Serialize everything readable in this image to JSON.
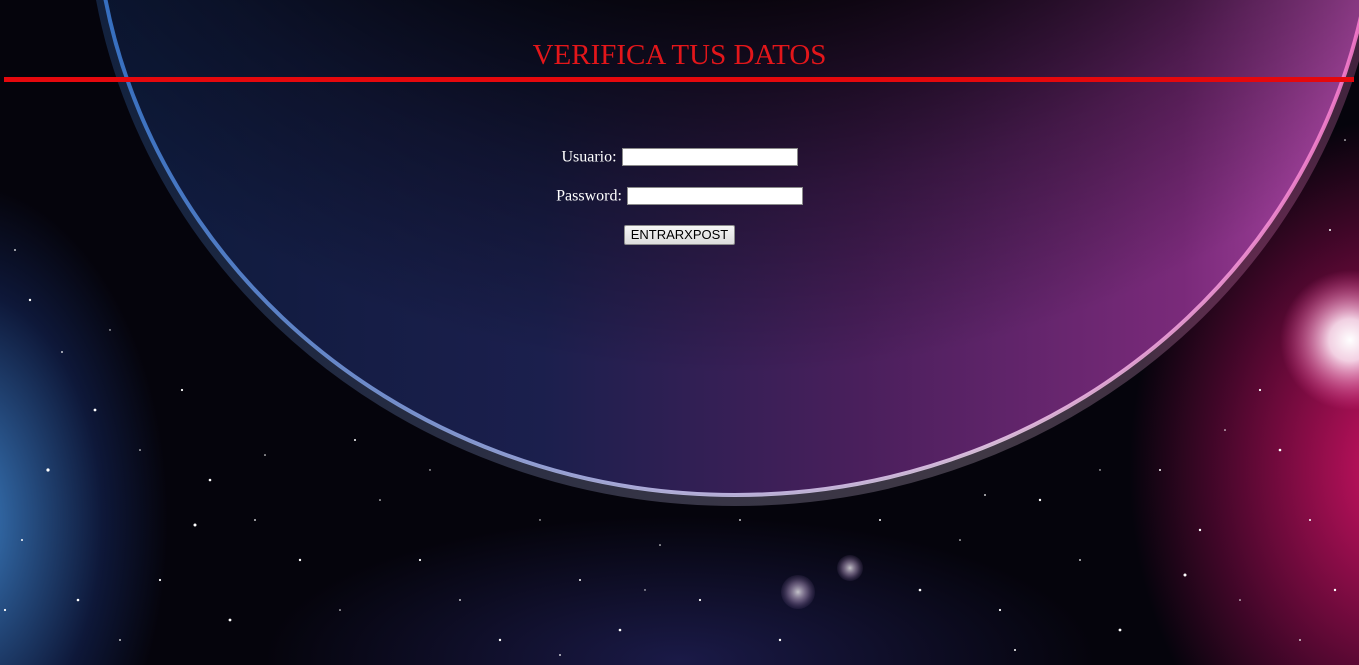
{
  "header": {
    "title": "VERIFICA TUS DATOS"
  },
  "login_form": {
    "username_label": "Usuario:",
    "username_value": "",
    "password_label": "Password:",
    "password_value": "",
    "submit_label": "ENTRARXPOST"
  },
  "colors": {
    "title": "#e3161a",
    "rule": "#e5080d",
    "label_text": "#ffffff",
    "background": "#05040c",
    "planet_blue_rim": "#4d8fe0",
    "planet_pink_rim": "#e21a78"
  },
  "background_image": {
    "subject": "space-planet-nebula"
  }
}
